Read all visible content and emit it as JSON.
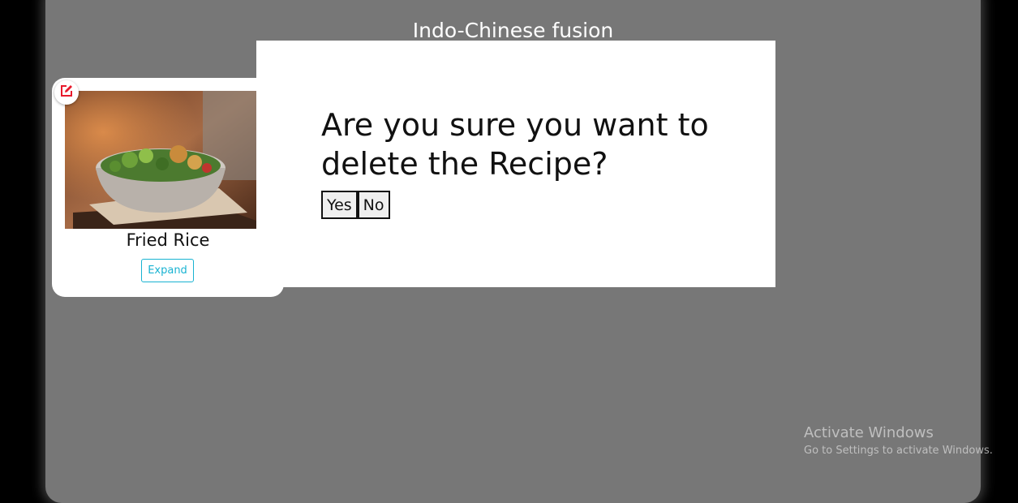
{
  "page": {
    "heading": "Indo-Chinese fusion"
  },
  "recipe_card": {
    "title": "Fried Rice",
    "expand_label": "Expand",
    "edit_icon": "edit-icon",
    "accent_color": "#19b3d2",
    "edit_icon_color": "#e81a2c"
  },
  "modal": {
    "question": "Are you sure you want to delete the Recipe?",
    "yes_label": "Yes",
    "no_label": "No"
  },
  "watermark": {
    "title": "Activate Windows",
    "subtitle": "Go to Settings to activate Windows."
  },
  "colors": {
    "overlay": "#777777",
    "modal_background": "#ffffff"
  }
}
